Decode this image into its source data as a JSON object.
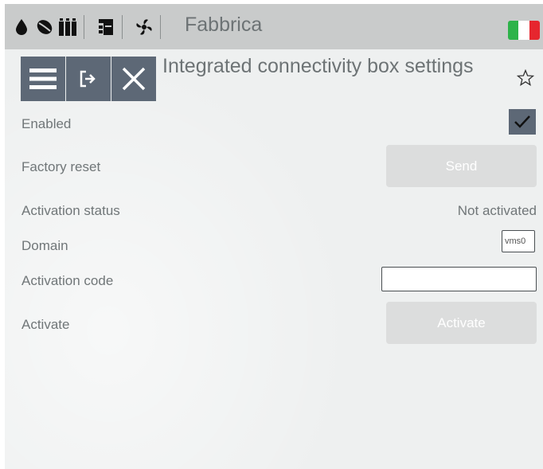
{
  "header": {
    "app_title": "Fabbrica",
    "icons": [
      "drop-icon",
      "coffee-bean-icon",
      "grinder-icon",
      "machine-icon",
      "fan-icon"
    ],
    "flag_colors": [
      "#2eb34a",
      "#ffffff",
      "#e6262e"
    ]
  },
  "toolbar": {
    "menu_icon": "menu-icon",
    "exit_icon": "exit-icon",
    "close_icon": "close-icon"
  },
  "page": {
    "title": "Integrated connectivity box settings",
    "favorite_icon": "star-outline-icon"
  },
  "settings": {
    "enabled_label": "Enabled",
    "enabled_checked": true,
    "factory_reset_label": "Factory reset",
    "send_button_label": "Send",
    "activation_status_label": "Activation status",
    "activation_status_value": "Not activated",
    "domain_label": "Domain",
    "domain_value": "vms0",
    "activation_code_label": "Activation code",
    "activation_code_value": "",
    "activate_label": "Activate",
    "activate_button_label": "Activate"
  },
  "colors": {
    "toolbar_button": "#5d6876",
    "disabled_button": "#dcdddd",
    "header_bg": "#c9cbcb",
    "page_bg": "#eef0f0"
  }
}
